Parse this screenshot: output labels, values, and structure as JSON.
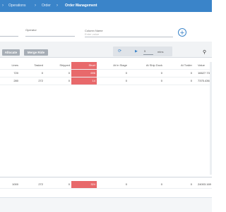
{
  "breadcrumb": {
    "items": [
      "Operations",
      "Order",
      "Order Management"
    ]
  },
  "filters": {
    "operator_label": "Operator",
    "column_name_label": "Column Name",
    "column_name_placeholder": "Enter value",
    "add_icon": "plus-circle-icon"
  },
  "toolbar": {
    "allocate_label": "Allocate",
    "merge_ride_label": "Merge Ride",
    "player_value": "5",
    "player_unit": "mins",
    "refresh_icon": "refresh-icon",
    "play_icon": "play-icon",
    "search_icon": "search-icon"
  },
  "table": {
    "columns": [
      "Lines",
      "Tasked",
      "Shipped",
      "Short",
      "At In Stage",
      "At Ship Dock",
      "At Trailer",
      "Value"
    ],
    "rows": [
      [
        "720",
        "0",
        "0",
        "696",
        "0",
        "0",
        "0",
        "16627.736"
      ],
      [
        "280",
        "272",
        "0",
        "14",
        "0",
        "0",
        "0",
        "7375.436"
      ]
    ],
    "totals": [
      "1000",
      "272",
      "0",
      "324",
      "0",
      "0",
      "0",
      "24003.169"
    ]
  },
  "colors": {
    "header_blue": "#3a84c9",
    "short_red": "#e8696b",
    "button_gray": "#a7aeb6"
  }
}
